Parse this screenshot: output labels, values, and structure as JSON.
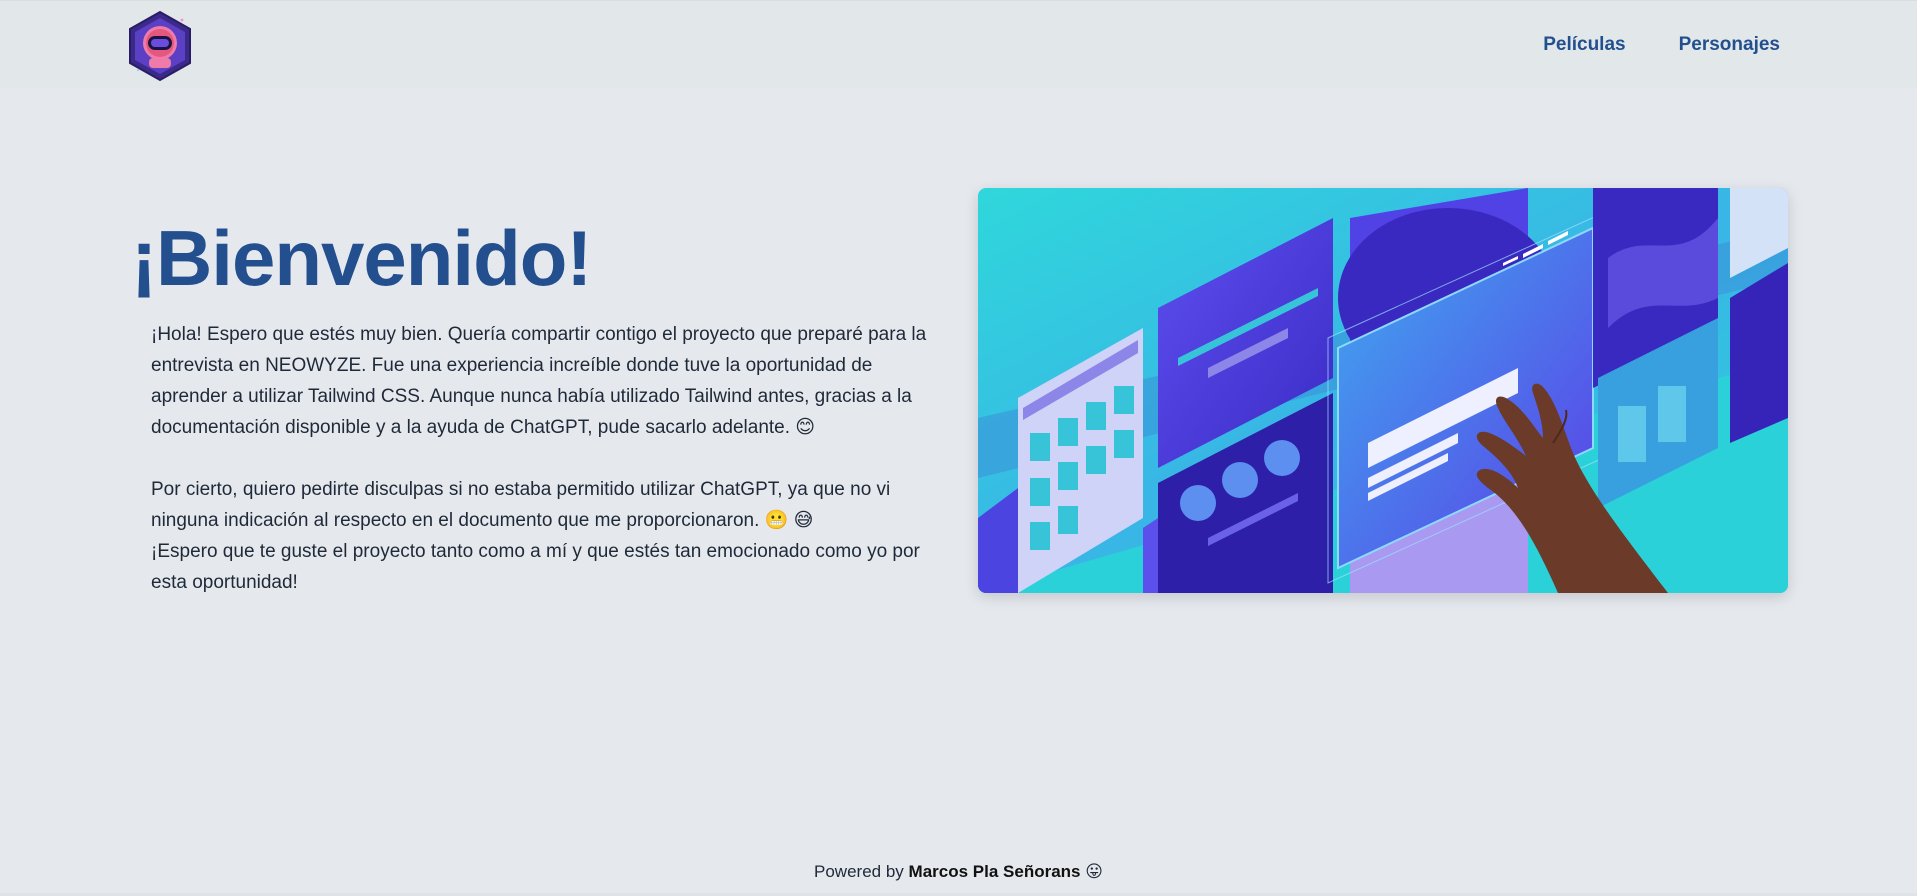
{
  "navbar": {
    "logo_alt": "astronaut-logo",
    "links": [
      {
        "label": "Películas"
      },
      {
        "label": "Personajes"
      }
    ]
  },
  "hero": {
    "title": "¡Bienvenido!",
    "paragraph1": "¡Hola! Espero que estés muy bien. Quería compartir contigo el proyecto que preparé para la entrevista en NEOWYZE. Fue una experiencia increíble donde tuve la oportunidad de aprender a utilizar Tailwind CSS. Aunque nunca había utilizado Tailwind antes, gracias a la documentación disponible y a la ayuda de ChatGPT, pude sacarlo adelante. 😊",
    "paragraph2": "Por cierto, quiero pedirte disculpas si no estaba permitido utilizar ChatGPT, ya que no vi ninguna indicación al respecto en el documento que me proporcionaron. 😬 😅",
    "paragraph3": "¡Espero que te guste el proyecto tanto como a mí y que estés tan emocionado como yo por esta oportunidad!"
  },
  "footer": {
    "prefix": "Powered by",
    "author": "Marcos Pla Señorans",
    "emoji": "😛"
  },
  "colors": {
    "accent": "#234f8f",
    "background": "#e5e9ee",
    "navbar_bg": "#e2e8e9",
    "illustration_cyan": "#2bd1d9",
    "illustration_indigo": "#4f3de0"
  }
}
